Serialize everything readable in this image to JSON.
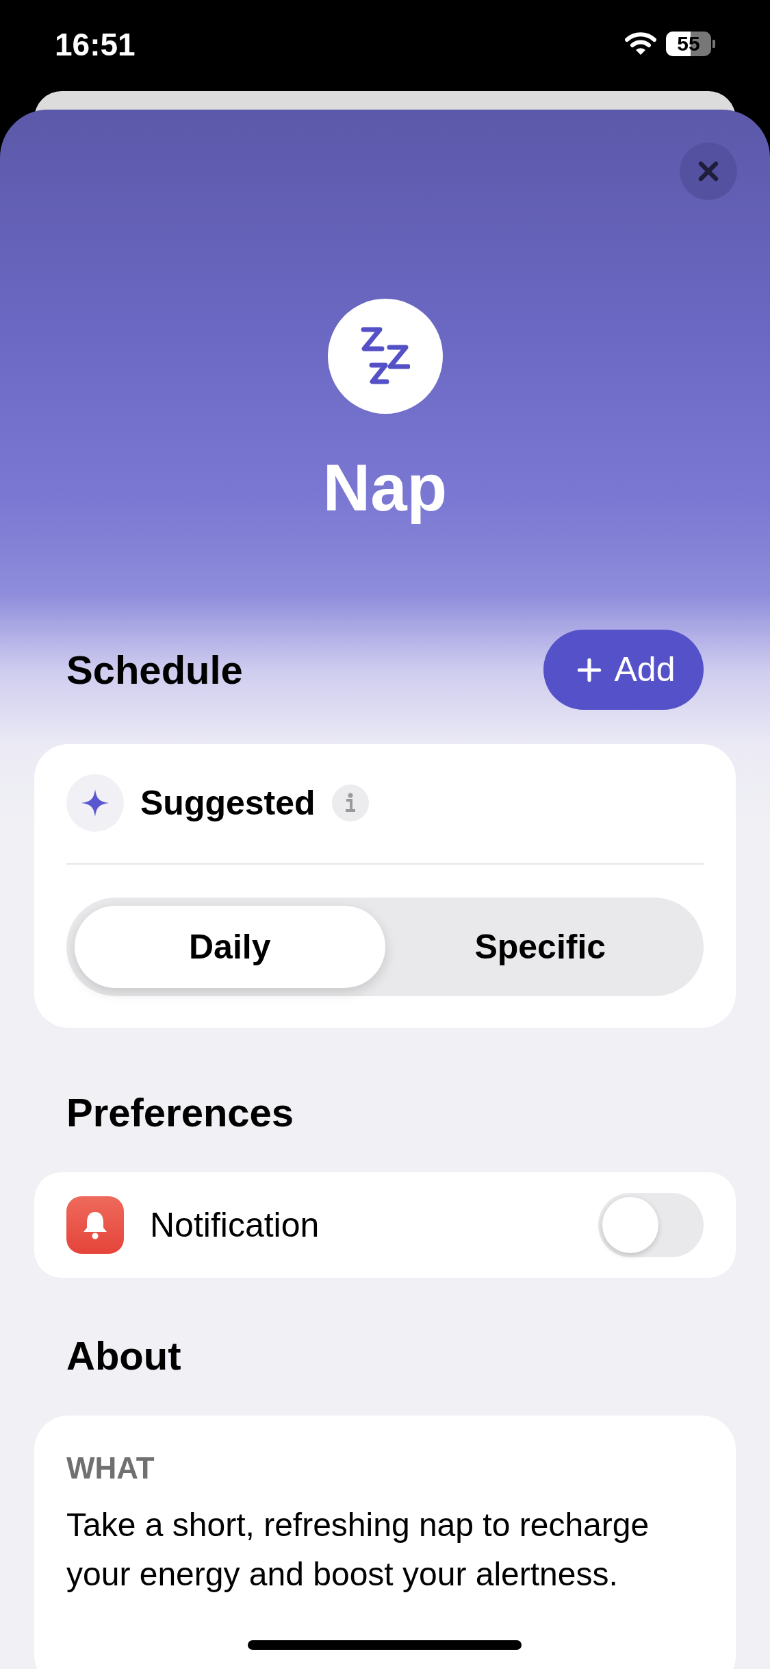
{
  "status_bar": {
    "time": "16:51",
    "battery": "55"
  },
  "header": {
    "title": "Nap"
  },
  "schedule": {
    "heading": "Schedule",
    "add_button": "Add",
    "suggested": {
      "label": "Suggested"
    },
    "segments": [
      {
        "label": "Daily",
        "selected": true
      },
      {
        "label": "Specific",
        "selected": false
      }
    ]
  },
  "preferences": {
    "heading": "Preferences",
    "items": [
      {
        "label": "Notification",
        "on": false
      }
    ]
  },
  "about": {
    "heading": "About",
    "sections": [
      {
        "label": "WHAT",
        "text": "Take a short, refreshing nap to recharge your energy and boost your alertness."
      }
    ]
  }
}
